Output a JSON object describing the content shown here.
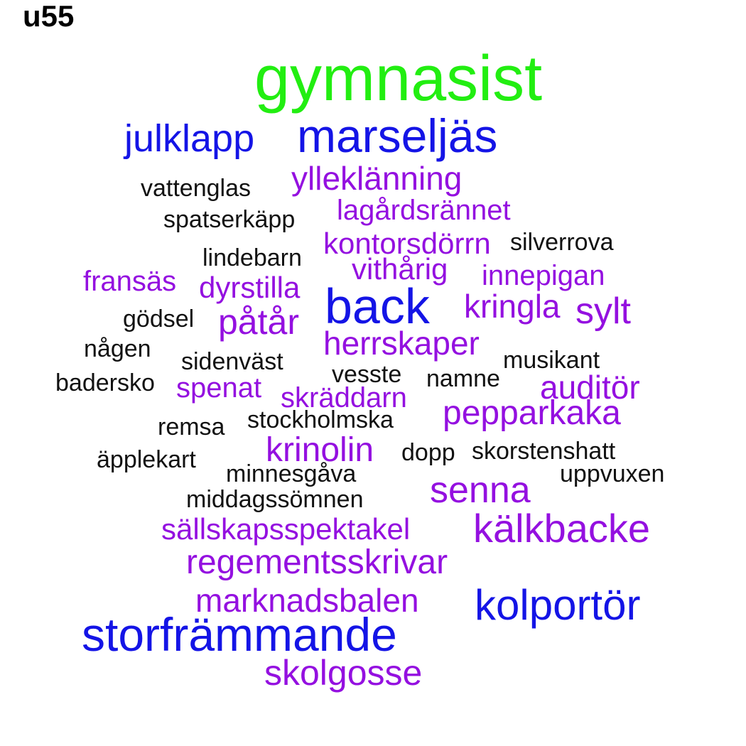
{
  "panel_title": "u55",
  "colors": {
    "green": "#22ee11",
    "blue": "#1414e6",
    "purple": "#9410e0",
    "black": "#111111"
  },
  "words": [
    {
      "text": "gymnasist",
      "color": "green"
    },
    {
      "text": "julklapp",
      "color": "blue"
    },
    {
      "text": "marseljäs",
      "color": "blue"
    },
    {
      "text": "ylleklänning",
      "color": "purple"
    },
    {
      "text": "vattenglas",
      "color": "black"
    },
    {
      "text": "lagårdsrännet",
      "color": "purple"
    },
    {
      "text": "spatserkäpp",
      "color": "black"
    },
    {
      "text": "kontorsdörrn",
      "color": "purple"
    },
    {
      "text": "silverrova",
      "color": "black"
    },
    {
      "text": "lindebarn",
      "color": "black"
    },
    {
      "text": "vithårig",
      "color": "purple"
    },
    {
      "text": "fransäs",
      "color": "purple"
    },
    {
      "text": "innepigan",
      "color": "purple"
    },
    {
      "text": "dyrstilla",
      "color": "purple"
    },
    {
      "text": "back",
      "color": "blue"
    },
    {
      "text": "kringla",
      "color": "purple"
    },
    {
      "text": "sylt",
      "color": "purple"
    },
    {
      "text": "gödsel",
      "color": "black"
    },
    {
      "text": "påtår",
      "color": "purple"
    },
    {
      "text": "herrskaper",
      "color": "purple"
    },
    {
      "text": "någen",
      "color": "black"
    },
    {
      "text": "sidenväst",
      "color": "black"
    },
    {
      "text": "musikant",
      "color": "black"
    },
    {
      "text": "vesste",
      "color": "black"
    },
    {
      "text": "badersko",
      "color": "black"
    },
    {
      "text": "spenat",
      "color": "purple"
    },
    {
      "text": "namne",
      "color": "black"
    },
    {
      "text": "auditör",
      "color": "purple"
    },
    {
      "text": "skräddarn",
      "color": "purple"
    },
    {
      "text": "pepparkaka",
      "color": "purple"
    },
    {
      "text": "stockholmska",
      "color": "black"
    },
    {
      "text": "remsa",
      "color": "black"
    },
    {
      "text": "krinolin",
      "color": "purple"
    },
    {
      "text": "dopp",
      "color": "black"
    },
    {
      "text": "skorstenshatt",
      "color": "black"
    },
    {
      "text": "äpplekart",
      "color": "black"
    },
    {
      "text": "minnesgåva",
      "color": "black"
    },
    {
      "text": "uppvuxen",
      "color": "black"
    },
    {
      "text": "senna",
      "color": "purple"
    },
    {
      "text": "middagssömnen",
      "color": "black"
    },
    {
      "text": "sällskapsspektakel",
      "color": "purple"
    },
    {
      "text": "kälkbacke",
      "color": "purple"
    },
    {
      "text": "regementsskrivar",
      "color": "purple"
    },
    {
      "text": "marknadsbalen",
      "color": "purple"
    },
    {
      "text": "kolportör",
      "color": "blue"
    },
    {
      "text": "storfrämmande",
      "color": "blue"
    },
    {
      "text": "skolgosse",
      "color": "purple"
    }
  ]
}
